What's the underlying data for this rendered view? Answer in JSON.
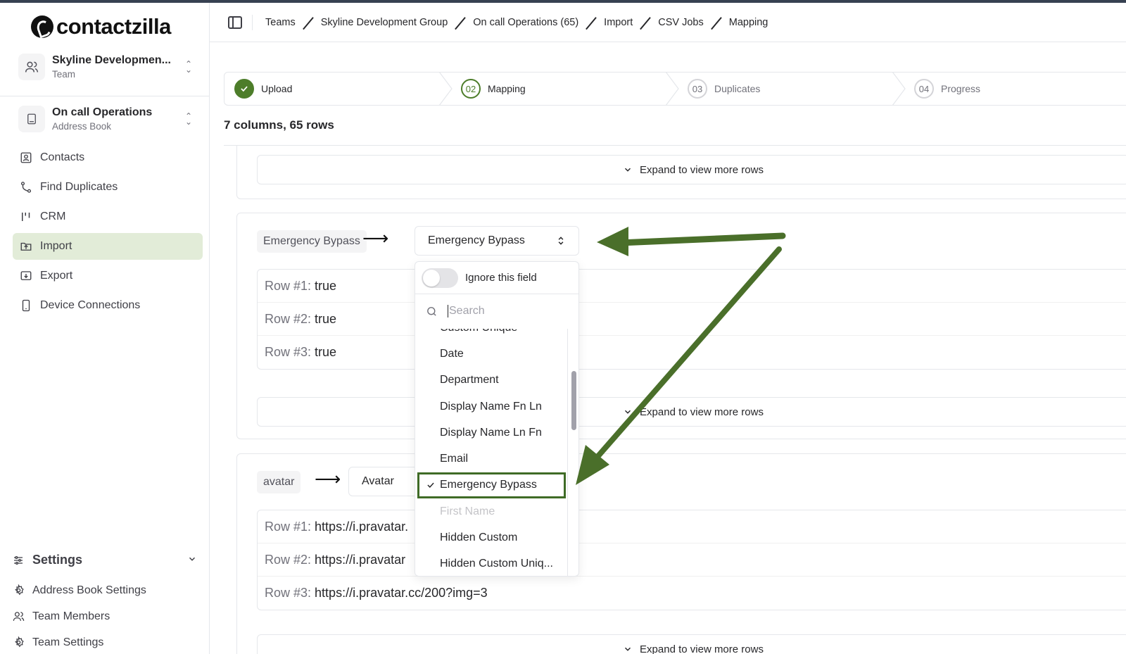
{
  "app": {
    "logo_text": "contactzilla"
  },
  "sidebar": {
    "team_switcher": {
      "title": "Skyline Developmen...",
      "subtitle": "Team"
    },
    "book_switcher": {
      "title": "On call Operations",
      "subtitle": "Address Book"
    },
    "nav": [
      {
        "label": "Contacts",
        "icon": "contacts-icon"
      },
      {
        "label": "Find Duplicates",
        "icon": "merge-icon"
      },
      {
        "label": "CRM",
        "icon": "crm-icon"
      },
      {
        "label": "Import",
        "icon": "import-icon",
        "active": true
      },
      {
        "label": "Export",
        "icon": "export-icon"
      },
      {
        "label": "Device Connections",
        "icon": "device-icon"
      }
    ],
    "settings": {
      "heading": "Settings",
      "items": [
        {
          "label": "Address Book Settings",
          "icon": "gear-icon"
        },
        {
          "label": "Team Members",
          "icon": "users-icon"
        },
        {
          "label": "Team Settings",
          "icon": "gear-icon"
        }
      ]
    }
  },
  "breadcrumb": [
    "Teams",
    "Skyline Development Group",
    "On call Operations (65)",
    "Import",
    "CSV Jobs",
    "Mapping"
  ],
  "stepper": [
    {
      "number": "",
      "label": "Upload",
      "state": "done"
    },
    {
      "number": "02",
      "label": "Mapping",
      "state": "current"
    },
    {
      "number": "03",
      "label": "Duplicates",
      "state": "pending"
    },
    {
      "number": "04",
      "label": "Progress",
      "state": "pending"
    }
  ],
  "summary": "7 columns, 65 rows",
  "expand_label": "Expand to view more rows",
  "mapping_emergency": {
    "source": "Emergency Bypass",
    "target": "Emergency Bypass",
    "rows": [
      {
        "label": "Row #1:",
        "value": "true"
      },
      {
        "label": "Row #2:",
        "value": "true"
      },
      {
        "label": "Row #3:",
        "value": "true"
      }
    ]
  },
  "mapping_avatar": {
    "source": "avatar",
    "target": "Avatar",
    "rows": [
      {
        "label": "Row #1:",
        "value": "https://i.pravatar."
      },
      {
        "label": "Row #2:",
        "value": "https://i.pravatar"
      },
      {
        "label": "Row #3:",
        "value": "https://i.pravatar.cc/200?img=3"
      }
    ]
  },
  "dropdown": {
    "ignore_label": "Ignore this field",
    "search_placeholder": "Search",
    "options": [
      "Custom Unique",
      "Date",
      "Department",
      "Display Name Fn Ln",
      "Display Name Ln Fn",
      "Email",
      "Emergency Bypass",
      "First Name",
      "Hidden Custom",
      "Hidden Custom Uniq..."
    ],
    "selected": "Emergency Bypass",
    "disabled": [
      "First Name"
    ]
  },
  "colors": {
    "accent": "#4d7d2a",
    "annotation_arrow": "#4a6f2a",
    "active_nav_bg": "#e2ecd8"
  }
}
